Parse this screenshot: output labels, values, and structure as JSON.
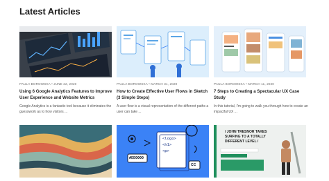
{
  "page": {
    "heading": "Latest Articles"
  },
  "articles": [
    {
      "meta": "PAULA BOROWSKA • JUNE 22, 2020",
      "title": "Using 6 Google Analytics Features to Improve User Experience and Website Metrics",
      "excerpt": "Google Analytics is a fantastic tool because it eliminates the guesswork as to how visitors ..."
    },
    {
      "meta": "PAULA BOROWSKA • MARCH 31, 2020",
      "title": "How to Create Effective User Flows in Sketch (3 Simple Steps)",
      "excerpt": "A user flow is a visual representation of the different paths a user can take ..."
    },
    {
      "meta": "PAULA BOROWSKA • MARCH 11, 2020",
      "title": "7 Steps to Creating a Spectacular UX Case Study",
      "excerpt": "In this tutorial, I'm going to walk you through how to create an impactful UX ..."
    }
  ],
  "bottom_cards": {
    "dev_icons": {
      "tag1": "<logo>",
      "tag2": "<h1>",
      "tag3": "<p>",
      "code": "#EE0000",
      "cc": "CC"
    },
    "banner": {
      "headline1": "/ JOHN TRESNOR TAKES",
      "headline2": "SURFING TO A TOTALLY",
      "headline3": "DIFFERENT LEVEL /"
    }
  },
  "colors": {
    "accent_blue": "#3b82f6",
    "text_dark": "#1e1e1e",
    "text_muted": "#6b6b6b"
  }
}
